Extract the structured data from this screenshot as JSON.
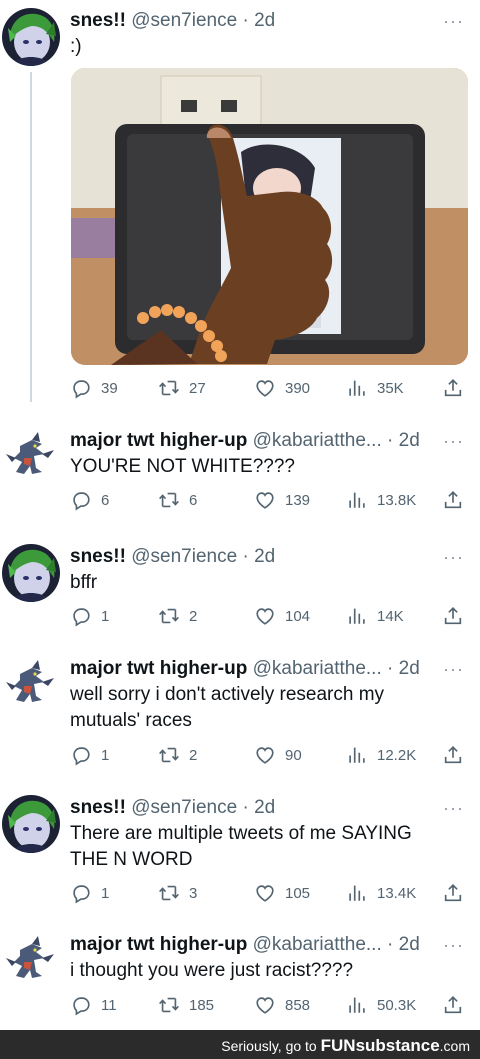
{
  "tweets": [
    {
      "name": "snes!!",
      "handle": "@sen7ience",
      "dot": "·",
      "time": "2d",
      "more": "···",
      "text": ":)",
      "avatar": "green-haired-character",
      "replies": "39",
      "retweets": "27",
      "likes": "390",
      "views": "35K"
    },
    {
      "name": "major twt higher-up",
      "handle": "@kabariatthe...",
      "dot": "·",
      "time": "2d",
      "more": "···",
      "text": "YOU'RE NOT WHITE????",
      "avatar": "garchomp-sprite",
      "replies": "6",
      "retweets": "6",
      "likes": "139",
      "views": "13.8K"
    },
    {
      "name": "snes!!",
      "handle": "@sen7ience",
      "dot": "·",
      "time": "2d",
      "more": "···",
      "text": "bffr",
      "avatar": "green-haired-character",
      "replies": "1",
      "retweets": "2",
      "likes": "104",
      "views": "14K"
    },
    {
      "name": "major twt higher-up",
      "handle": "@kabariatthe...",
      "dot": "·",
      "time": "2d",
      "more": "···",
      "text_line1": "well sorry i don't actively research my",
      "text_line2": "mutuals' races",
      "avatar": "garchomp-sprite",
      "replies": "1",
      "retweets": "2",
      "likes": "90",
      "views": "12.2K"
    },
    {
      "name": "snes!!",
      "handle": "@sen7ience",
      "dot": "·",
      "time": "2d",
      "more": "···",
      "text_line1": "There are multiple tweets of me SAYING",
      "text_line2": "THE N WORD",
      "avatar": "green-haired-character",
      "replies": "1",
      "retweets": "3",
      "likes": "105",
      "views": "13.4K"
    },
    {
      "name": "major twt higher-up",
      "handle": "@kabariatthe...",
      "dot": "·",
      "time": "2d",
      "more": "···",
      "text": "i thought you were just racist????",
      "avatar": "garchomp-sprite",
      "replies": "11",
      "retweets": "185",
      "likes": "858",
      "views": "50.3K"
    }
  ],
  "media": {
    "description_icon": "thumbs-up-photo"
  },
  "icons": {
    "reply": "reply-icon",
    "retweet": "retweet-icon",
    "like": "heart-icon",
    "views": "views-icon",
    "share": "share-icon"
  },
  "watermark": {
    "prefix": "Seriously, go to ",
    "brand": "FUNsubstance",
    "suffix": ".com"
  },
  "colors": {
    "text": "#0f1419",
    "secondary": "#536471",
    "thread_line": "#cfd9de"
  }
}
